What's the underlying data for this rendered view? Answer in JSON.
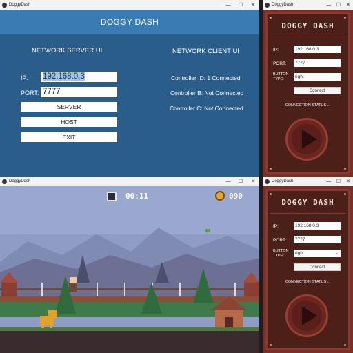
{
  "windows": {
    "server": {
      "title": "DoggyDash",
      "header": "DOGGY DASH",
      "server_section_title": "NETWORK SERVER UI",
      "client_section_title": "NETWORK CLIENT UI",
      "ip_label": "IP:",
      "ip_value": "192.168.0.3",
      "port_label": "PORT:",
      "port_value": "7777",
      "buttons": [
        "SERVER",
        "HOST",
        "EXIT"
      ],
      "controllers": [
        "Controller ID: 1 Connected",
        "Controller B: Not Connected",
        "Controller C: Not Connected"
      ]
    },
    "controller_top": {
      "title": "DoggyDash",
      "app_title": "DOGGY DASH",
      "ip_label": "IP:",
      "ip_value": "192.168.0.3",
      "port_label": "PORT:",
      "port_value": "7777",
      "button_type_label_1": "BUTTON",
      "button_type_label_2": "TYPE:",
      "button_type_value": "right",
      "connect_label": "Connect",
      "status_text": "CONNECTION STATUS ..."
    },
    "controller_bottom": {
      "title": "DoggyDash",
      "app_title": "DOGGY DASH",
      "ip_label": "IP:",
      "ip_value": "192.168.0.3",
      "port_label": "PORT:",
      "port_value": "7777",
      "button_type_label_1": "BUTTON",
      "button_type_label_2": "TYPE:",
      "button_type_value": "right",
      "connect_label": "Connect",
      "status_text": "CONNECTION STATUS ..."
    },
    "game": {
      "title": "DoggyDash",
      "timer": "00:11",
      "coins": "090"
    }
  },
  "window_controls": {
    "minimize": "—",
    "maximize": "☐",
    "close": "✕"
  },
  "icons": [
    "app-icon",
    "timer-icon",
    "coin-icon",
    "play-icon",
    "chevron-down-icon"
  ],
  "colors": {
    "server_bg": "#2a5d8a",
    "server_header": "#3a7bb4",
    "controller_bg": "#7a2e28",
    "controller_panel": "#4a2019",
    "sky": "#8c9cc4"
  }
}
